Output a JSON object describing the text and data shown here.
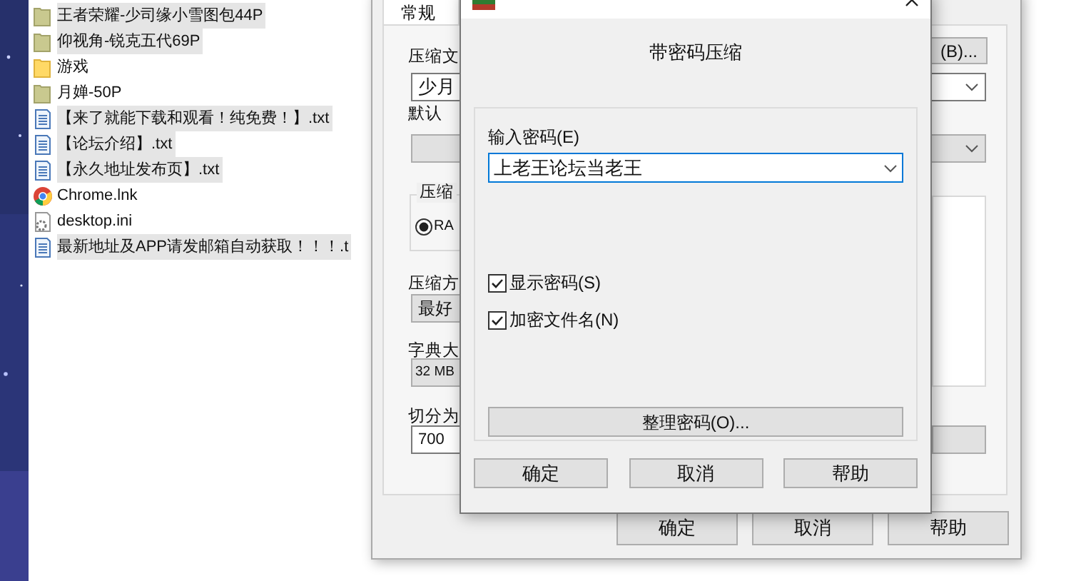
{
  "files": [
    {
      "name": "王者荣耀-少司缘小雪图包44P",
      "kind": "gallery",
      "selected": true
    },
    {
      "name": "仰视角-锐克五代69P",
      "kind": "gallery",
      "selected": true
    },
    {
      "name": "游戏",
      "kind": "folder",
      "selected": false
    },
    {
      "name": "月婵-50P",
      "kind": "gallery",
      "selected": false
    },
    {
      "name": "【来了就能下载和观看！纯免费！】.txt",
      "kind": "text",
      "selected": true
    },
    {
      "name": "【论坛介绍】.txt",
      "kind": "text",
      "selected": true
    },
    {
      "name": "【永久地址发布页】.txt",
      "kind": "text",
      "selected": true
    },
    {
      "name": "Chrome.lnk",
      "kind": "chrome",
      "selected": false
    },
    {
      "name": "desktop.ini",
      "kind": "config",
      "selected": false
    },
    {
      "name": "最新地址及APP请发邮箱自动获取！！！.t",
      "kind": "text",
      "selected": true
    }
  ],
  "archive_dialog": {
    "tab": "常规",
    "browse_button": "(B)...",
    "archive_name_label": "压缩文",
    "archive_name": "少月",
    "profile_label": "默认",
    "format_group": "压缩",
    "format_option": {
      "label": "RA",
      "checked": true
    },
    "method_label": "压缩方",
    "method": "最好",
    "dictionary_label": "字典大",
    "dictionary": "32 MB",
    "split_label": "切分为",
    "split": "700",
    "buttons": [
      "确定",
      "取消",
      "帮助"
    ]
  },
  "password_dialog": {
    "heading": "带密码压缩",
    "password_label": "输入密码(E)",
    "password": "上老王论坛当老王",
    "options": [
      {
        "label": "显示密码(S)",
        "checked": true
      },
      {
        "label": "加密文件名(N)",
        "checked": true
      }
    ],
    "organize_button": "整理密码(O)...",
    "buttons": [
      "确定",
      "取消",
      "帮助"
    ]
  }
}
